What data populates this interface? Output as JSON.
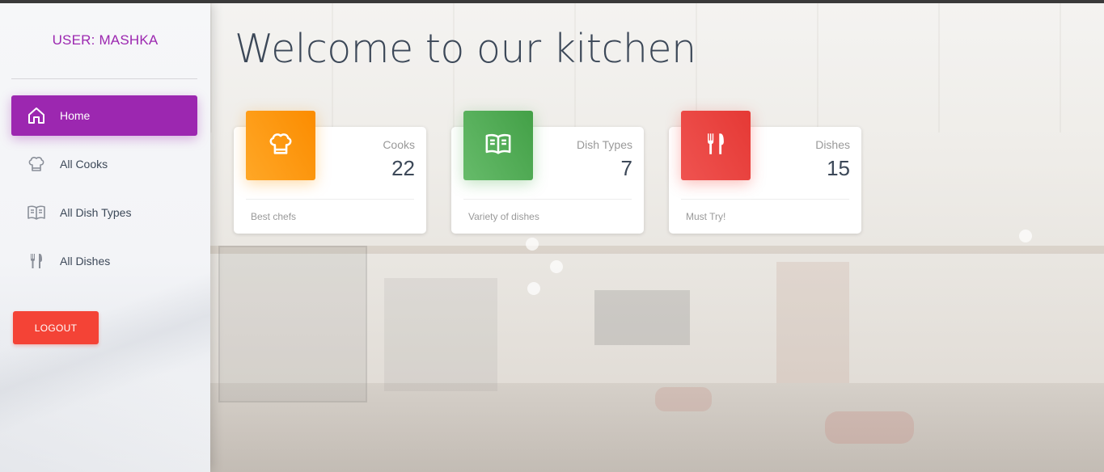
{
  "sidebar": {
    "user_title": "USER: MASHKA",
    "items": [
      {
        "label": "Home",
        "icon": "home-icon",
        "active": true
      },
      {
        "label": "All Cooks",
        "icon": "chef-hat-icon",
        "active": false
      },
      {
        "label": "All Dish Types",
        "icon": "book-icon",
        "active": false
      },
      {
        "label": "All Dishes",
        "icon": "utensils-icon",
        "active": false
      }
    ],
    "logout_label": "LOGOUT"
  },
  "main": {
    "title": "Welcome to our kitchen",
    "cards": [
      {
        "label": "Cooks",
        "value": "22",
        "footer": "Best chefs",
        "icon": "chef-hat-icon",
        "color": "#fb8c00"
      },
      {
        "label": "Dish Types",
        "value": "7",
        "footer": "Variety of dishes",
        "icon": "book-icon",
        "color": "#43a047"
      },
      {
        "label": "Dishes",
        "value": "15",
        "footer": "Must Try!",
        "icon": "utensils-icon",
        "color": "#e53935"
      }
    ]
  },
  "colors": {
    "primary": "#9c27b0",
    "danger": "#f44336",
    "text": "#3c4858"
  }
}
